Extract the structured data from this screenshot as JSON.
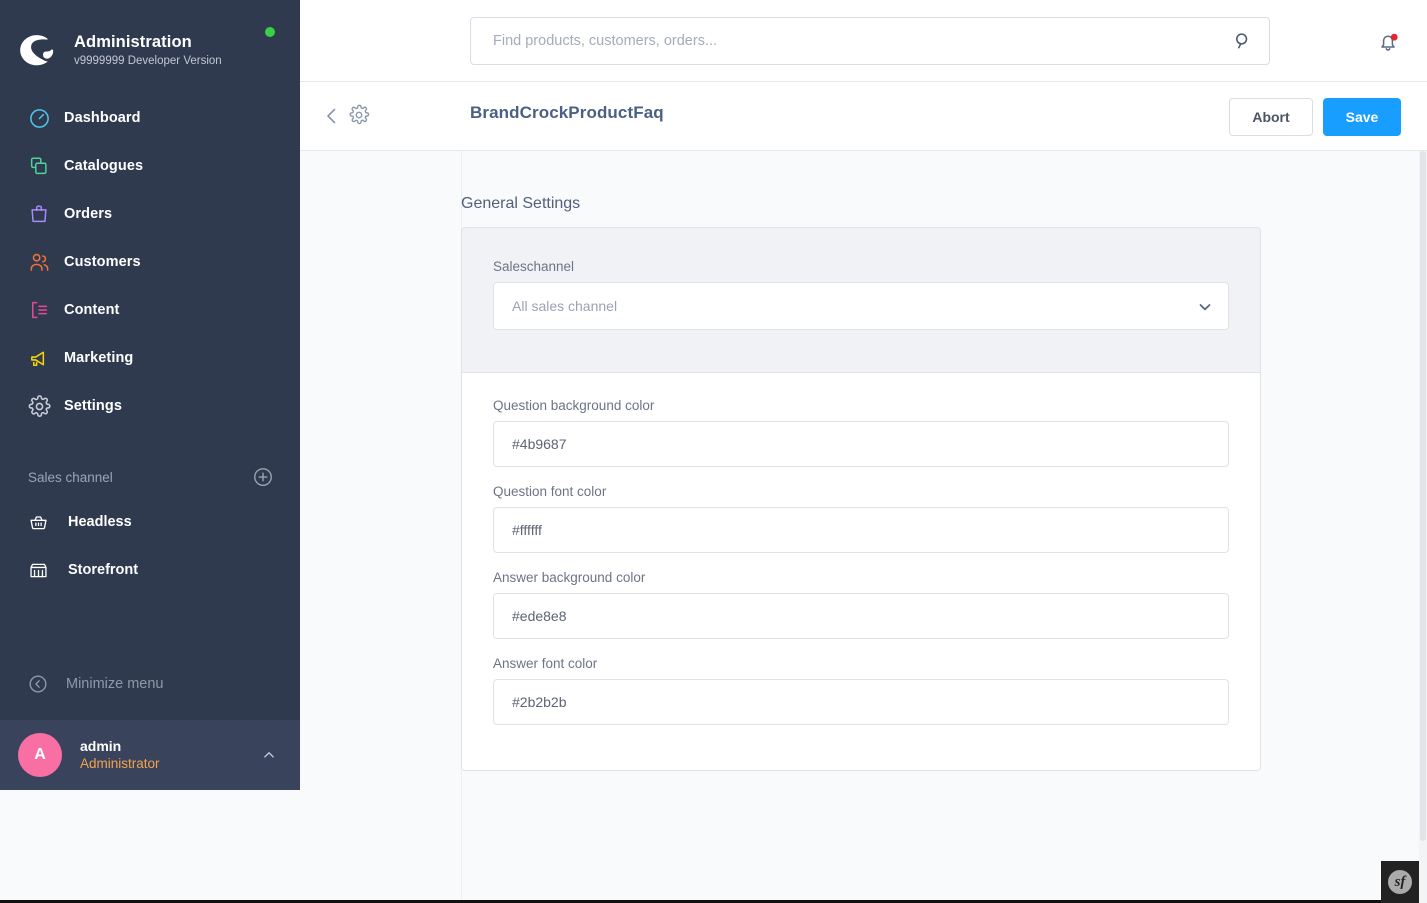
{
  "brand": {
    "title": "Administration",
    "version": "v9999999 Developer Version",
    "status_color": "#37d046",
    "logo_icon": "shopware-logo-icon"
  },
  "sidebar": {
    "items": [
      {
        "label": "Dashboard",
        "icon": "dashboard-icon",
        "color": "#4fc6e8"
      },
      {
        "label": "Catalogues",
        "icon": "catalogues-icon",
        "color": "#4dd599"
      },
      {
        "label": "Orders",
        "icon": "orders-icon",
        "color": "#a78bfa"
      },
      {
        "label": "Customers",
        "icon": "customers-icon",
        "color": "#f0713c"
      },
      {
        "label": "Content",
        "icon": "content-icon",
        "color": "#ec4899"
      },
      {
        "label": "Marketing",
        "icon": "marketing-icon",
        "color": "#f5d400"
      },
      {
        "label": "Settings",
        "icon": "settings-gear-icon",
        "color": "#c9ced8"
      }
    ],
    "sales_channel": {
      "title": "Sales channel",
      "add_icon": "add-circle-icon",
      "channels": [
        {
          "label": "Headless",
          "icon": "headless-basket-icon"
        },
        {
          "label": "Storefront",
          "icon": "storefront-icon"
        }
      ]
    },
    "minimize": {
      "label": "Minimize menu",
      "icon": "collapse-left-icon"
    },
    "user": {
      "initial": "A",
      "name": "admin",
      "role": "Administrator",
      "avatar_color": "#f86fa3",
      "role_color": "#f5a14c",
      "caret_icon": "chevron-up-icon"
    }
  },
  "topbar": {
    "search": {
      "placeholder": "Find products, customers, orders...",
      "value": "",
      "icon": "search-icon"
    },
    "notifications": {
      "icon": "bell-icon",
      "badge": true,
      "badge_color": "#e3262f"
    }
  },
  "page_header": {
    "back_icon": "chevron-left-icon",
    "gear_icon": "settings-gear-icon",
    "title": "BrandCrockProductFaq",
    "buttons": {
      "abort": "Abort",
      "save": "Save",
      "save_color": "#189eff"
    }
  },
  "main": {
    "section_title": "General Settings",
    "saleschannel": {
      "label": "Saleschannel",
      "selected": "All sales channel",
      "caret_icon": "chevron-down-icon"
    },
    "fields": [
      {
        "label": "Question background color",
        "value": "#4b9687"
      },
      {
        "label": "Question font color",
        "value": "#ffffff"
      },
      {
        "label": "Answer background color",
        "value": "#ede8e8"
      },
      {
        "label": "Answer font color",
        "value": "#2b2b2b"
      }
    ]
  },
  "debug_toolbar": {
    "logo": "sf",
    "name": "symfony-profiler-icon"
  }
}
